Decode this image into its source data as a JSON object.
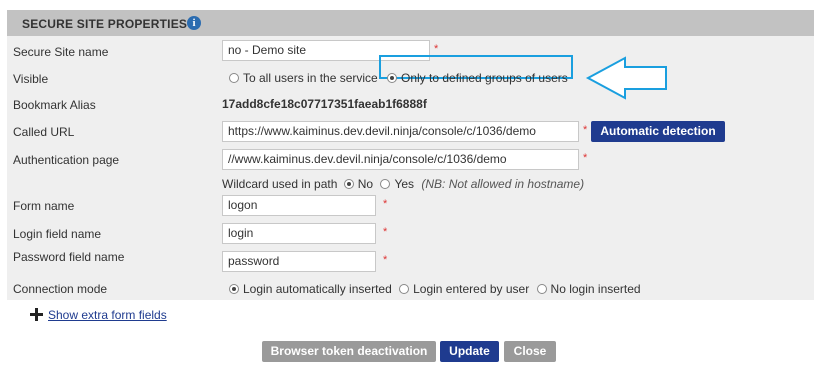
{
  "panel": {
    "title": "SECURE SITE PROPERTIES",
    "info_icon": "info-icon"
  },
  "fields": {
    "secure_site_name": {
      "label": "Secure Site name",
      "value": "no - Demo site",
      "required": "*"
    },
    "visible": {
      "label": "Visible",
      "options": [
        "To all users in the service",
        "Only to defined groups of users"
      ],
      "selected": "Only to defined groups of users"
    },
    "bookmark_alias": {
      "label": "Bookmark Alias",
      "value": "17add8cfe18c07717351faeab1f6888f"
    },
    "called_url": {
      "label": "Called URL",
      "value": "https://www.kaiminus.dev.devil.ninja/console/c/1036/demo",
      "required": "*",
      "button": "Automatic detection"
    },
    "authentication_page": {
      "label": "Authentication page",
      "value": "//www.kaiminus.dev.devil.ninja/console/c/1036/demo",
      "required": "*"
    },
    "wildcard": {
      "label": "Wildcard used in path",
      "options": [
        "No",
        "Yes"
      ],
      "selected": "No",
      "note": "(NB: Not allowed in hostname)"
    },
    "form_name": {
      "label": "Form name",
      "value": "logon",
      "required": "*"
    },
    "login_field_name": {
      "label": "Login field name",
      "value": "login",
      "required": "*"
    },
    "password_field_name": {
      "label": "Password field name",
      "value": "password",
      "required": "*"
    },
    "connection_mode": {
      "label": "Connection mode",
      "options": [
        "Login automatically inserted",
        "Login entered by user",
        "No login inserted"
      ],
      "selected": "Login automatically inserted"
    }
  },
  "extra_link": "Show extra form fields",
  "buttons": {
    "token": "Browser token deactivation",
    "update": "Update",
    "close": "Close"
  },
  "colors": {
    "accent": "#1f3b8f",
    "highlight": "#1a9fdf",
    "header": "#c2c2c2",
    "panel": "#efefef"
  }
}
